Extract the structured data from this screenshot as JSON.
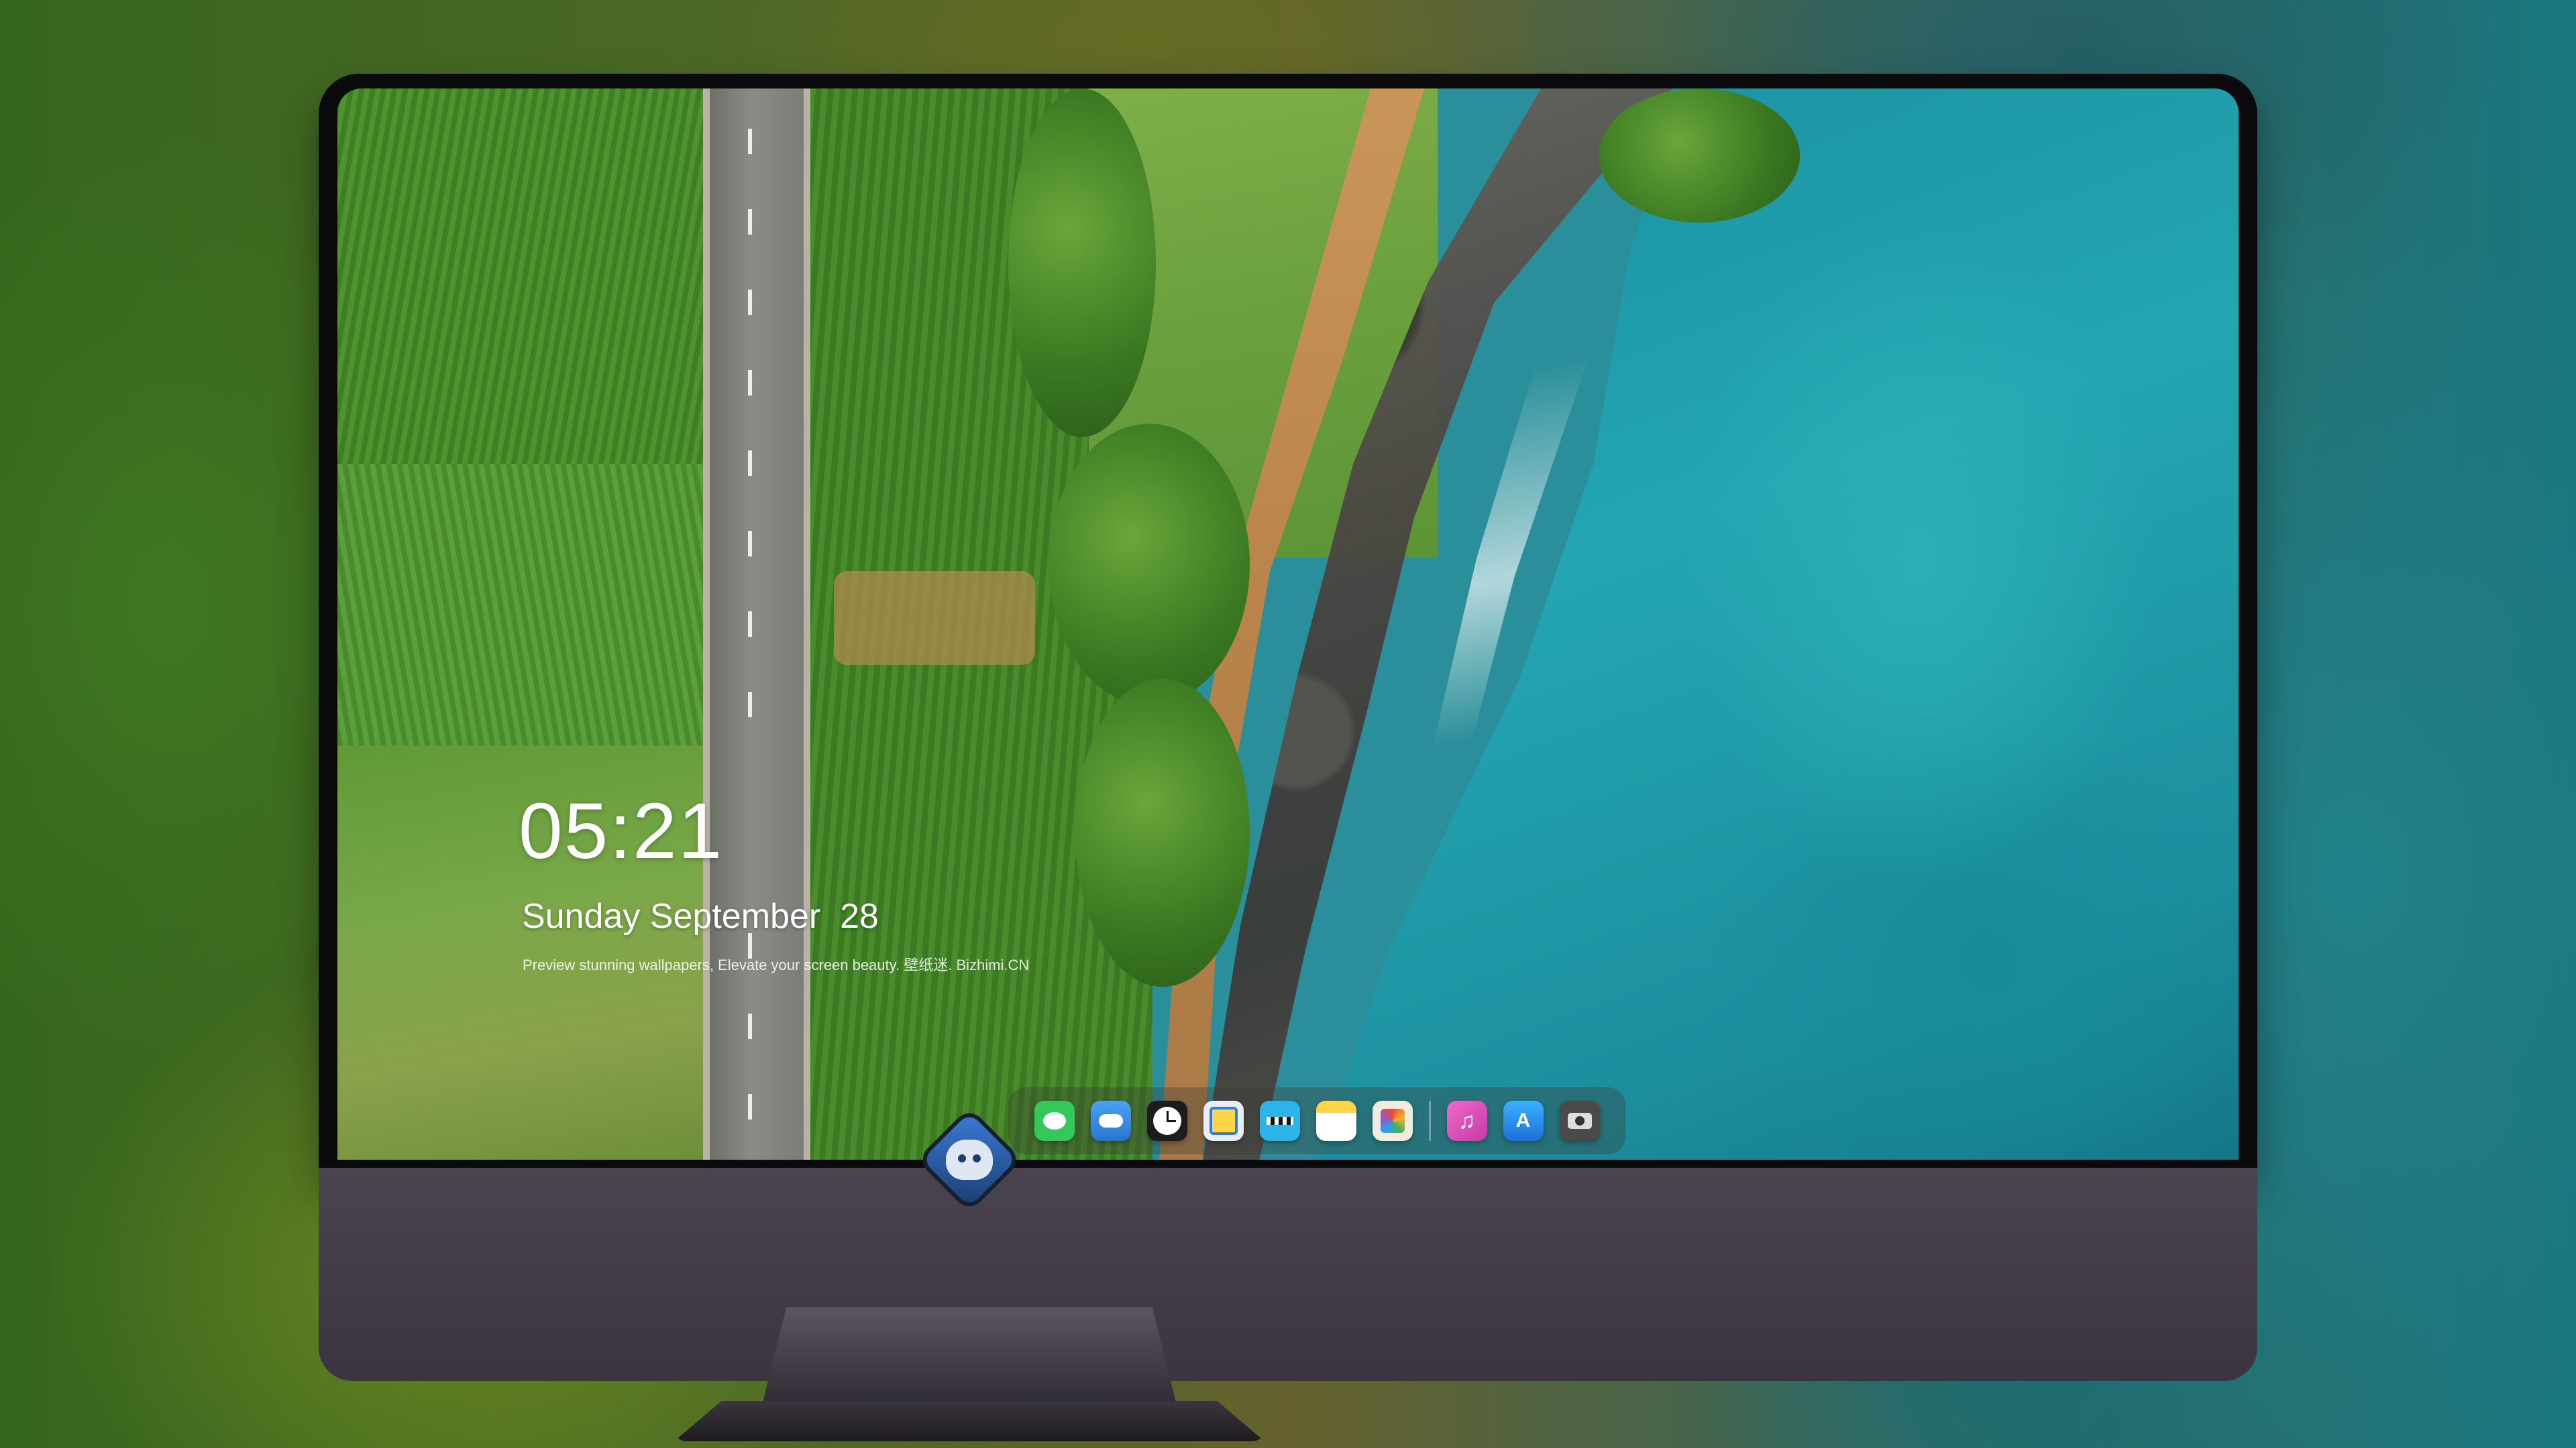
{
  "lock_screen": {
    "time": "05:21",
    "date": "Sunday September  28",
    "tagline": "Preview stunning wallpapers, Elevate your screen beauty. 壁纸迷. Bizhimi.CN"
  },
  "dock": {
    "apps": [
      {
        "name": "Messages",
        "icon": "messages-icon",
        "color": "#34c759"
      },
      {
        "name": "Weather",
        "icon": "weather-icon",
        "color": "#3a8ee6"
      },
      {
        "name": "Clock",
        "icon": "clock-icon",
        "color": "#1c1c1e"
      },
      {
        "name": "Preview",
        "icon": "preview-icon",
        "color": "#7fb3e8"
      },
      {
        "name": "Clips",
        "icon": "clips-icon",
        "color": "#2cb3e8"
      },
      {
        "name": "Notes",
        "icon": "notes-icon",
        "color": "#ffd54a"
      },
      {
        "name": "Photos",
        "icon": "photos-icon",
        "color": "#e8e0d0"
      },
      {
        "name": "Music",
        "icon": "music-icon",
        "color": "#e040a0"
      },
      {
        "name": "App Store",
        "icon": "app-store-icon",
        "color": "#1e90ff"
      },
      {
        "name": "Camera",
        "icon": "camera-icon",
        "color": "#555555"
      }
    ]
  },
  "colors": {
    "bezel": "#0b0b0d",
    "chin": "#453e4a",
    "sea": "#23a6b2"
  }
}
